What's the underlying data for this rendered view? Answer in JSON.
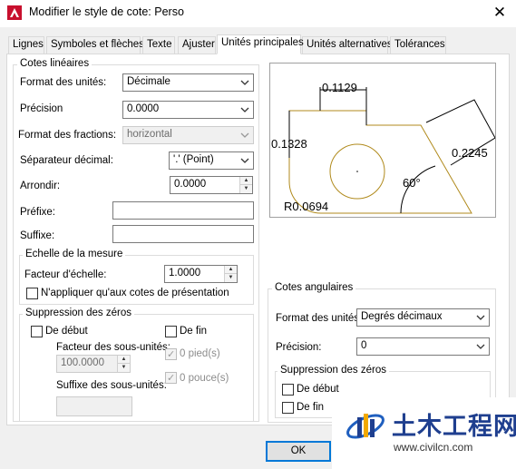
{
  "window": {
    "title": "Modifier le style de cote: Perso",
    "app_icon": "autocad-a-icon",
    "close_icon": "close-icon"
  },
  "tabs": [
    "Lignes",
    "Symboles et flèches",
    "Texte",
    "Ajuster",
    "Unités principales",
    "Unités alternatives",
    "Tolérances"
  ],
  "active_tab": "Unités principales",
  "linear": {
    "legend": "Cotes linéaires",
    "unit_format_label": "Format des unités:",
    "unit_format_value": "Décimale",
    "precision_label": "Précision",
    "precision_value": "0.0000",
    "fraction_format_label": "Format des fractions:",
    "fraction_format_value": "horizontal",
    "decimal_sep_label": "Séparateur décimal:",
    "decimal_sep_value": "'.' (Point)",
    "round_label": "Arrondir:",
    "round_value": "0.0000",
    "prefix_label": "Préfixe:",
    "prefix_value": "",
    "suffix_label": "Suffixe:",
    "suffix_value": ""
  },
  "scale": {
    "legend": "Echelle de la mesure",
    "factor_label": "Facteur d'échelle:",
    "factor_value": "1.0000",
    "layout_only_label": "N'appliquer qu'aux cotes de présentation",
    "layout_only_checked": false
  },
  "zero_suppression": {
    "legend": "Suppression des zéros",
    "leading_label": "De début",
    "trailing_label": "De fin",
    "subunit_factor_label": "Facteur des sous-unités:",
    "subunit_factor_value": "100.0000",
    "subunit_suffix_label": "Suffixe des sous-unités:",
    "subunit_suffix_value": "",
    "feet_label": "0 pied(s)",
    "inches_label": "0 pouce(s)"
  },
  "preview": {
    "dim_top": "0.1129",
    "dim_left": "0.1328",
    "dim_right": "0.2245",
    "angle": "60°",
    "radius": "R0.0694"
  },
  "angular": {
    "legend": "Cotes angulaires",
    "unit_format_label": "Format des unités:",
    "unit_format_value": "Degrés décimaux",
    "precision_label": "Précision:",
    "precision_value": "0",
    "zero_legend": "Suppression des zéros",
    "leading_label": "De début",
    "trailing_label": "De fin"
  },
  "buttons": {
    "ok": "OK"
  },
  "watermark": {
    "title": "土木工程网",
    "url": "www.civilcn.com"
  }
}
